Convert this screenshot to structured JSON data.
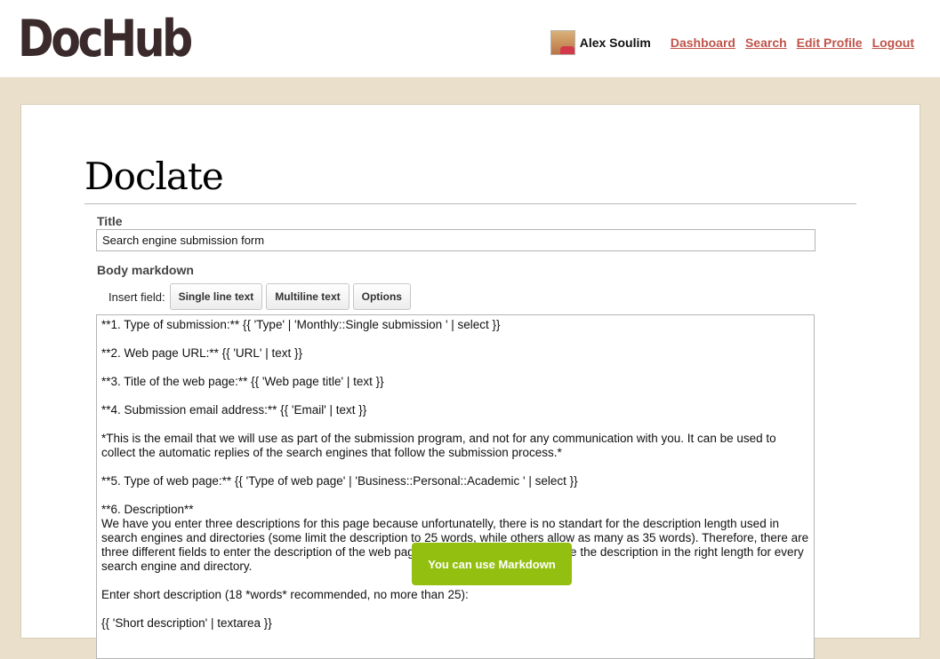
{
  "app": {
    "logo": "DocHub"
  },
  "user": {
    "name": "Alex Soulim",
    "nav": [
      "Dashboard",
      "Search",
      "Edit Profile",
      "Logout"
    ]
  },
  "page": {
    "title": "Doclate",
    "title_label": "Title",
    "title_value": "Search engine submission form",
    "body_label": "Body markdown",
    "insert_label": "Insert field:",
    "insert_buttons": [
      "Single line text",
      "Multiline text",
      "Options"
    ],
    "body_lines": [
      "**1. Type of submission:** {{ 'Type' | 'Monthly::Single submission ' | select }}",
      "**2. Web page URL:** {{ 'URL' | text }}",
      "**3. Title of the web page:** {{ 'Web page title' | text }}",
      "**4. Submission email address:** {{ 'Email' | text }}",
      "*This is the email that we will use as part of the submission program, and not for any communication with you. It can be used to collect the automatic replies of the search engines that follow the submission process.*",
      "**5. Type of web page:** {{ 'Type of web page' | 'Business::Personal::Academic ' | select }}",
      "**6. Description**\nWe have you enter three descriptions for this page because unfortunatelly, there is no standart for the description length used in search engines and directories (some limit the description to 25 words, while others allow as many as 35 words). Therefore, there are three different fields to enter the description of the web page, so that LTD Inc. can provide the description in the right length for every search engine and directory.",
      "Enter short description (18 *words* recommended, no more than 25):",
      "{{ 'Short description' | textarea }}"
    ],
    "tooltip": "You can use Markdown"
  }
}
